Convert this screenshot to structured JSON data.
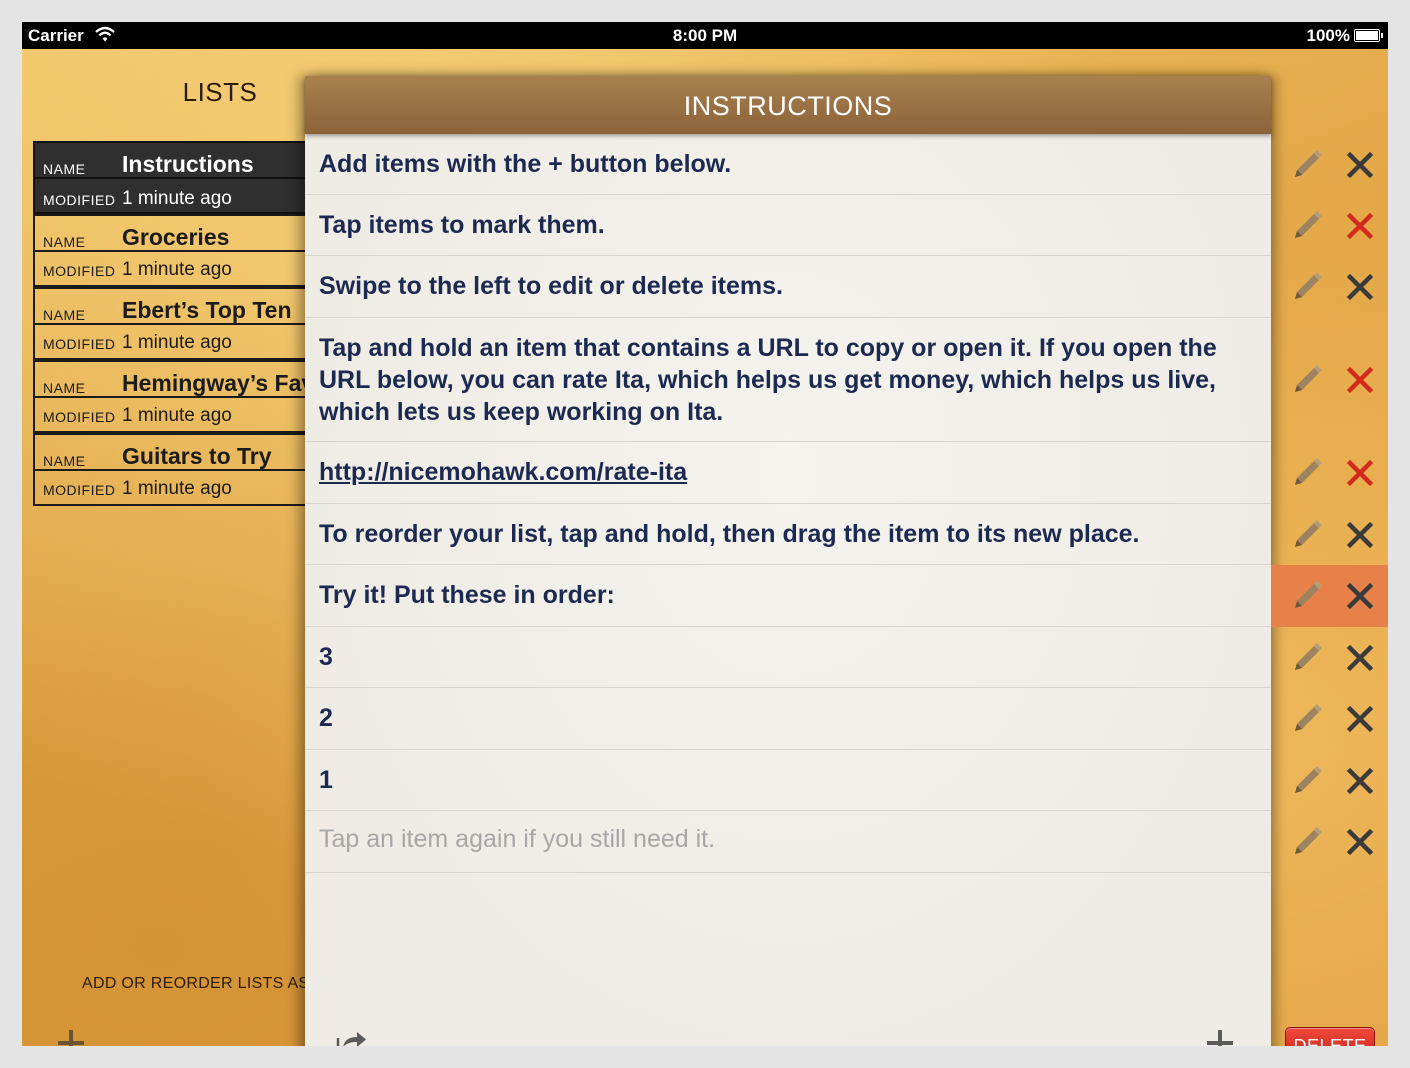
{
  "status_bar": {
    "carrier": "Carrier",
    "time": "8:00 PM",
    "battery": "100%"
  },
  "lists_pane": {
    "title": "LISTS",
    "name_tag": "NAME",
    "modified_tag": "MODIFIED",
    "items": [
      {
        "name": "Instructions",
        "modified": "1 minute ago",
        "selected": true
      },
      {
        "name": "Groceries",
        "modified": "1 minute ago"
      },
      {
        "name": "Ebert’s Top Ten",
        "modified": "1 minute ago"
      },
      {
        "name": "Hemingway’s Favorites",
        "modified": "1 minute ago"
      },
      {
        "name": "Guitars to Try",
        "modified": "1 minute ago"
      }
    ],
    "hint": "ADD OR REORDER LISTS AS NEEDED",
    "add_icon": "plus-icon"
  },
  "note": {
    "title": "INSTRUCTIONS",
    "items": [
      {
        "text": "Add items with the + button below.",
        "delete_color": "dark"
      },
      {
        "text": "Tap items to mark them.",
        "delete_color": "red"
      },
      {
        "text": "Swipe to the left to edit or delete items.",
        "delete_color": "dark"
      },
      {
        "text": "Tap and hold an item that contains a URL to copy or open it. If you open the URL below, you can rate Ita, which helps us get money, which helps us live, which lets us keep working on Ita.",
        "delete_color": "red"
      },
      {
        "text": "http://nicemohawk.com/rate-ita",
        "delete_color": "red",
        "link": true
      },
      {
        "text": "To reorder your list, tap and hold, then drag the item to its new place.",
        "delete_color": "dark"
      },
      {
        "text": "Try it! Put these in order:",
        "delete_color": "dark",
        "highlight": true
      },
      {
        "text": "3",
        "delete_color": "dark"
      },
      {
        "text": "2",
        "delete_color": "dark"
      },
      {
        "text": "1",
        "delete_color": "dark"
      }
    ],
    "new_item_placeholder": "Tap an item again if you still need it.",
    "share_icon": "share-icon",
    "add_icon": "plus-icon"
  },
  "actions": {
    "delete_button": "DELETE"
  },
  "colors": {
    "red_x": "#d42a1d",
    "dark_x": "#3a3a3a",
    "highlight_row": "#e8804a",
    "item_text": "#1c2a52",
    "header_bar": "#9a7043"
  }
}
